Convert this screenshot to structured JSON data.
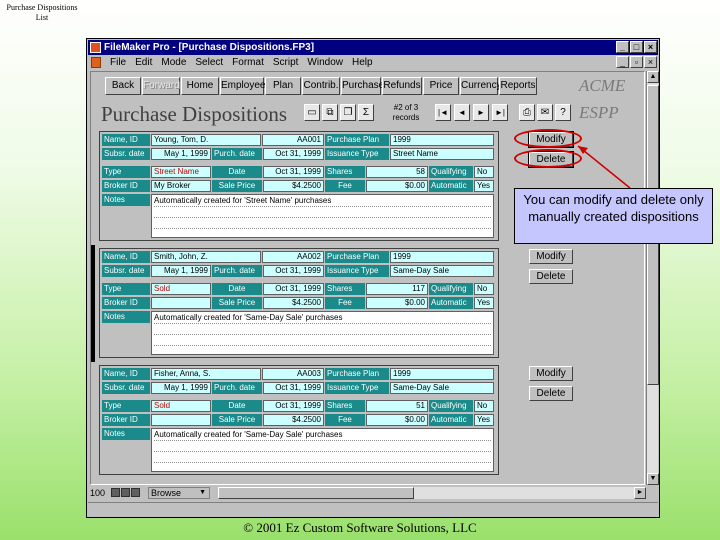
{
  "slide": {
    "title": "Purchase Dispositions List",
    "footer": "© 2001 Ez Custom Software Solutions, LLC"
  },
  "window": {
    "title": "FileMaker Pro - [Purchase Dispositions.FP3]",
    "title_buttons": [
      "_",
      "□",
      "×"
    ],
    "menu": [
      "File",
      "Edit",
      "Mode",
      "Select",
      "Format",
      "Script",
      "Window",
      "Help"
    ],
    "menu_right": [
      "_",
      "▫",
      "×"
    ]
  },
  "nav": {
    "buttons": [
      "Back",
      "Forward",
      "Home",
      "Employee",
      "Plan",
      "Contrib.",
      "Purchase",
      "Refunds",
      "Price",
      "Currency",
      "Reports"
    ],
    "dimmed": "Forward",
    "brand_top": "ACME",
    "brand_bottom": "ESPP"
  },
  "form": {
    "title": "Purchase Dispositions",
    "record_num": "#2 of 3",
    "record_word": "records",
    "tool_icons": [
      "new-record-icon",
      "duplicate-record-icon",
      "copy-record-icon",
      "sum-icon"
    ],
    "tool_glyphs": [
      "▭",
      "⧉",
      "❐",
      "Σ"
    ],
    "recnav_glyphs": [
      "|◄",
      "◄",
      "►",
      "►|"
    ],
    "print_glyphs": [
      "⎙",
      "✉",
      "?"
    ]
  },
  "labels": {
    "name_id": "Name, ID",
    "subscr_date": "Subsr. date",
    "purch_date": "Purch. date",
    "purchase_plan": "Purchase Plan",
    "issuance_type": "Issuance Type",
    "type": "Type",
    "date": "Date",
    "shares": "Shares",
    "qualifying": "Qualifying",
    "broker_id": "Broker ID",
    "sale_price": "Sale Price",
    "fee": "Fee",
    "automatic": "Automatic",
    "notes": "Notes",
    "modify": "Modify",
    "delete": "Delete"
  },
  "records": [
    {
      "name": "Young, Tom, D.",
      "id": "AA001",
      "plan": "1999",
      "subscr_date": "May 1, 1999",
      "purch_date": "Oct 31, 1999",
      "issuance_type": "Street Name",
      "type": "Street Name",
      "date": "Oct 31, 1999",
      "shares": "58",
      "qualifying": "No",
      "broker_id": "My Broker",
      "sale_price": "$4.2500",
      "fee": "$0.00",
      "automatic": "Yes",
      "notes": "Automatically created for 'Street Name' purchases"
    },
    {
      "name": "Smith, John, Z.",
      "id": "AA002",
      "plan": "1999",
      "subscr_date": "May 1, 1999",
      "purch_date": "Oct 31, 1999",
      "issuance_type": "Same-Day Sale",
      "type": "Sold",
      "date": "Oct 31, 1999",
      "shares": "117",
      "qualifying": "No",
      "broker_id": "",
      "sale_price": "$4.2500",
      "fee": "$0.00",
      "automatic": "Yes",
      "notes": "Automatically created for 'Same-Day Sale' purchases"
    },
    {
      "name": "Fisher, Anna, S.",
      "id": "AA003",
      "plan": "1999",
      "subscr_date": "May 1, 1999",
      "purch_date": "Oct 31, 1999",
      "issuance_type": "Same-Day Sale",
      "type": "Sold",
      "date": "Oct 31, 1999",
      "shares": "51",
      "qualifying": "No",
      "broker_id": "",
      "sale_price": "$4.2500",
      "fee": "$0.00",
      "automatic": "Yes",
      "notes": "Automatically created for 'Same-Day Sale' purchases"
    }
  ],
  "statusbar": {
    "zoom": "100",
    "mode": "Browse"
  },
  "callout": {
    "text": "You can modify and delete only manually created dispositions"
  },
  "colors": {
    "label_bg": "#1a8a8a",
    "field_bg": "#ccffff",
    "red_value": "#cc0000",
    "callout_bg": "#c6c6ff",
    "highlight": "#d00000"
  }
}
